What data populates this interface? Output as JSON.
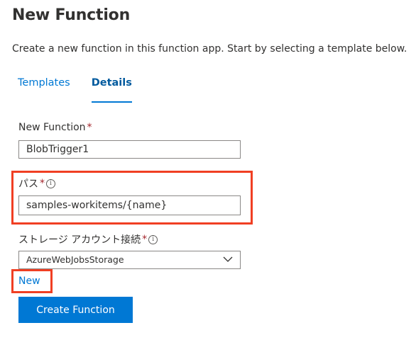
{
  "page": {
    "title": "New Function",
    "subtitle": "Create a new function in this function app. Start by selecting a template below."
  },
  "tabs": [
    {
      "label": "Templates",
      "active": false
    },
    {
      "label": "Details",
      "active": true
    }
  ],
  "form": {
    "function_name": {
      "label": "New Function",
      "required_mark": "*",
      "value": "BlobTrigger1"
    },
    "path": {
      "label": "パス",
      "required_mark": "*",
      "info_icon": "info-icon",
      "value": "samples-workitems/{name}"
    },
    "storage_connection": {
      "label": "ストレージ アカウント接続",
      "required_mark": "*",
      "info_icon": "info-icon",
      "selected": "AzureWebJobsStorage"
    },
    "new_link": "New",
    "create_button": "Create Function"
  },
  "colors": {
    "accent": "#0078d4",
    "required": "#a4262c",
    "highlight": "#f03f23"
  }
}
